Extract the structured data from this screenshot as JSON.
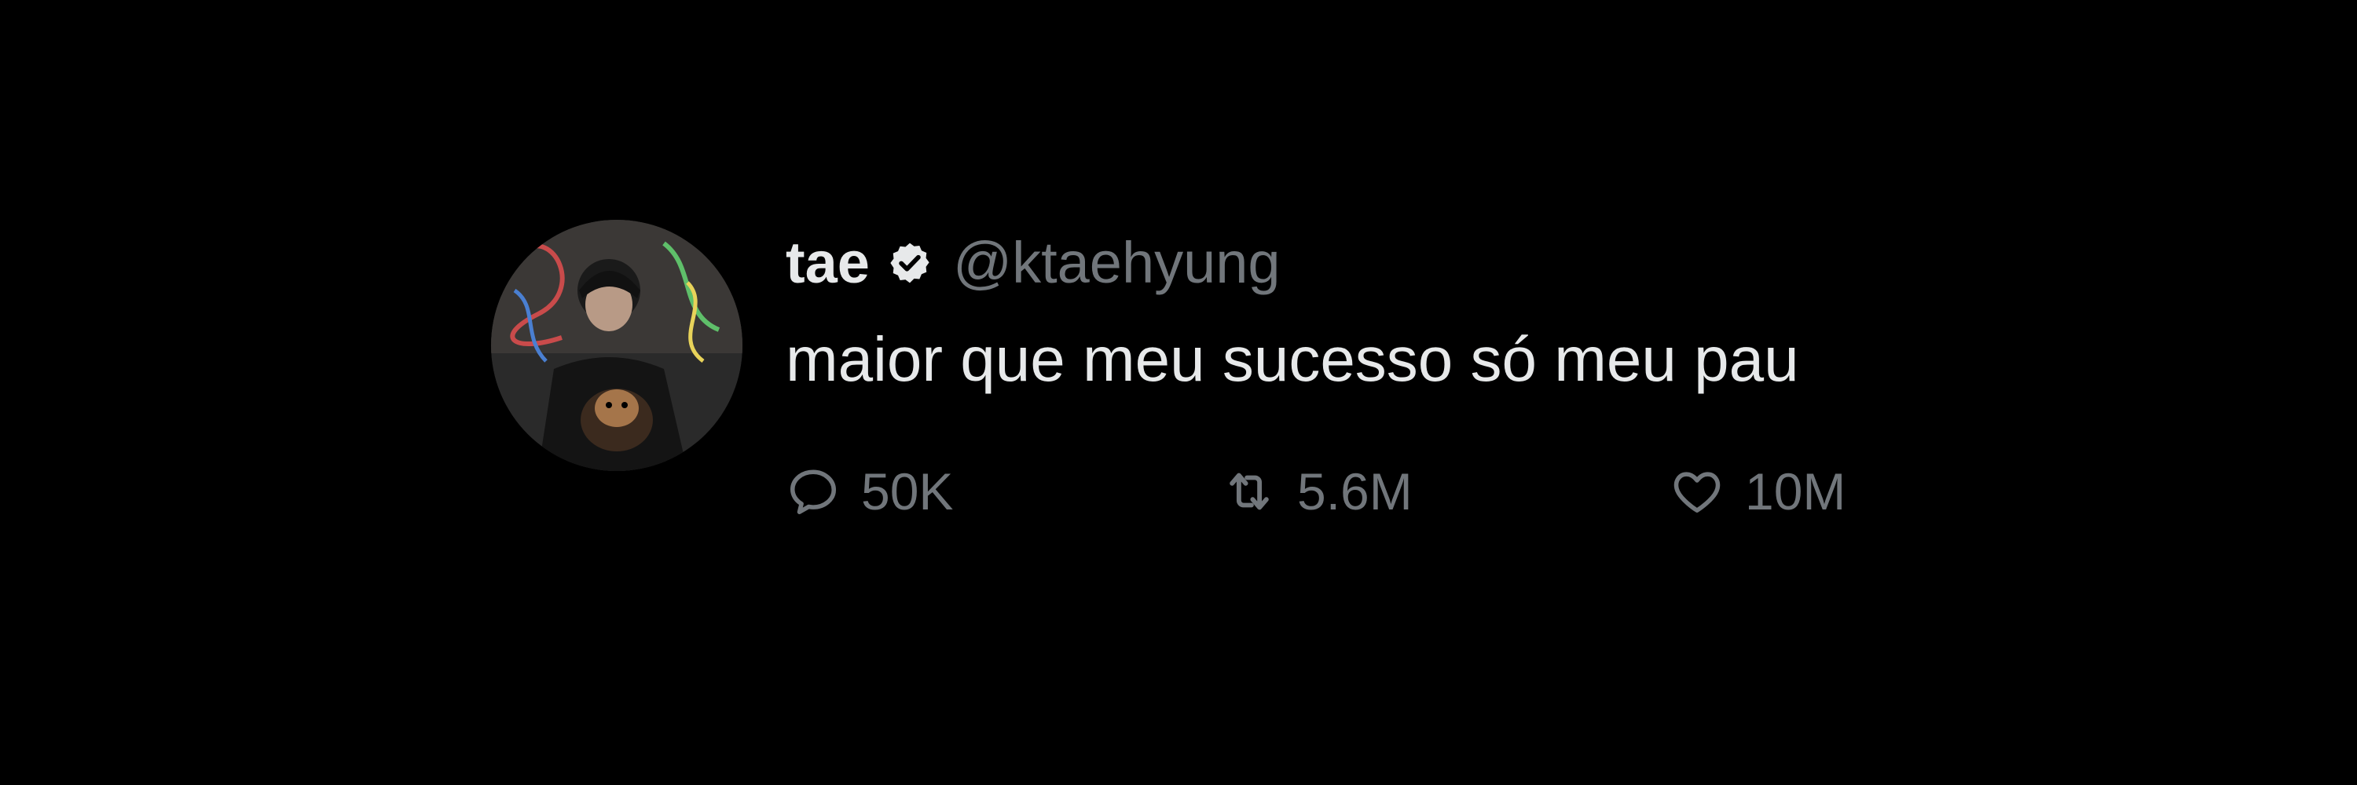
{
  "tweet": {
    "display_name": "tae",
    "handle": "@ktaehyung",
    "text": "maior que meu sucesso só meu pau",
    "verified_icon": "verified-badge-icon",
    "avatar_icon": "profile-avatar"
  },
  "actions": {
    "reply": {
      "icon": "reply-icon",
      "count": "50K"
    },
    "retweet": {
      "icon": "retweet-icon",
      "count": "5.6M"
    },
    "like": {
      "icon": "heart-icon",
      "count": "10M"
    }
  },
  "colors": {
    "background": "#000000",
    "primary_text": "#e7e9ea",
    "secondary_text": "#71767b"
  }
}
